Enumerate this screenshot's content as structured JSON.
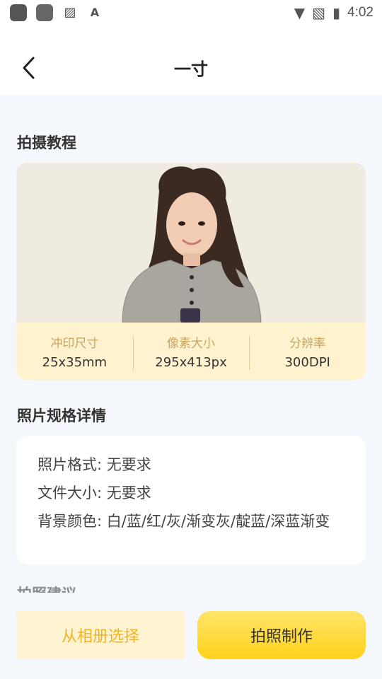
{
  "status_bar": {
    "time": "4:02",
    "left_icons": [
      "accessibility-icon",
      "app-icon",
      "image-icon",
      "font-icon"
    ],
    "right_icons": [
      "wifi-icon",
      "no-sim-icon",
      "battery-charging-icon"
    ]
  },
  "nav": {
    "back_icon": "chevron-left",
    "title": "一寸"
  },
  "tutorial": {
    "title": "拍摄教程",
    "specs": [
      {
        "label": "冲印尺寸",
        "value": "25x35mm"
      },
      {
        "label": "像素大小",
        "value": "295x413px"
      },
      {
        "label": "分辨率",
        "value": "300DPI"
      }
    ]
  },
  "details": {
    "title": "照片规格详情",
    "lines": [
      "照片格式: 无要求",
      "文件大小: 无要求",
      "背景颜色: 白/蓝/红/灰/渐变灰/靛蓝/深蓝渐变"
    ]
  },
  "next_section_title": "拍照建议",
  "buttons": {
    "album": "从相册选择",
    "shoot": "拍照制作"
  },
  "colors": {
    "accent_yellow": "#ffd21a",
    "album_text": "#f0b428",
    "spec_label": "#c8a45e",
    "spec_bg": "#fff3cf"
  }
}
